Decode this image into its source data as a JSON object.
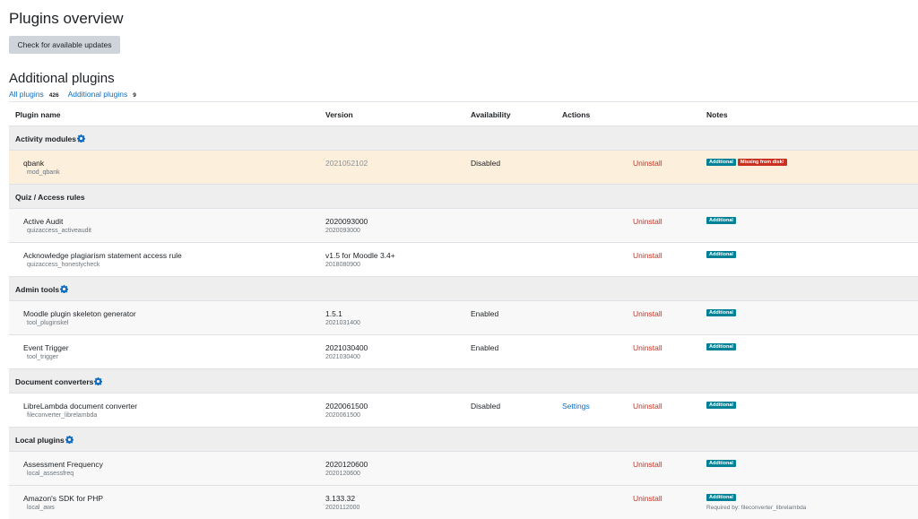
{
  "page_title": "Plugins overview",
  "check_updates_label": "Check for available updates",
  "section_title": "Additional plugins",
  "filters": {
    "all_label": "All plugins",
    "all_count": "426",
    "additional_label": "Additional plugins",
    "additional_count": "9"
  },
  "columns": [
    "Plugin name",
    "Version",
    "Availability",
    "Actions",
    "Notes"
  ],
  "labels": {
    "uninstall": "Uninstall",
    "settings": "Settings",
    "additional": "Additional",
    "missing": "Missing from disk!"
  },
  "groups": [
    {
      "title": "Activity modules",
      "has_icon": true,
      "plugins": [
        {
          "name": "qbank",
          "component": "mod_qbank",
          "version": "2021052102",
          "version_sub": "",
          "availability": "Disabled",
          "settings": "",
          "missing": true,
          "required_by": ""
        }
      ]
    },
    {
      "title": "Quiz / Access rules",
      "has_icon": false,
      "plugins": [
        {
          "name": "Active Audit",
          "component": "quizaccess_activeaudit",
          "version": "2020093000",
          "version_sub": "2020093000",
          "availability": "",
          "settings": "",
          "missing": false,
          "required_by": ""
        },
        {
          "name": "Acknowledge plagiarism statement access rule",
          "component": "quizaccess_honestycheck",
          "version": "v1.5 for Moodle 3.4+",
          "version_sub": "2018080900",
          "availability": "",
          "settings": "",
          "missing": false,
          "required_by": ""
        }
      ]
    },
    {
      "title": "Admin tools",
      "has_icon": true,
      "plugins": [
        {
          "name": "Moodle plugin skeleton generator",
          "component": "tool_pluginskel",
          "version": "1.5.1",
          "version_sub": "2021031400",
          "availability": "Enabled",
          "settings": "",
          "missing": false,
          "required_by": ""
        },
        {
          "name": "Event Trigger",
          "component": "tool_trigger",
          "version": "2021030400",
          "version_sub": "2021030400",
          "availability": "Enabled",
          "settings": "",
          "missing": false,
          "required_by": ""
        }
      ]
    },
    {
      "title": "Document converters",
      "has_icon": true,
      "plugins": [
        {
          "name": "LibreLambda document converter",
          "component": "fileconverter_librelambda",
          "version": "2020061500",
          "version_sub": "2020061500",
          "availability": "Disabled",
          "settings": "Settings",
          "missing": false,
          "required_by": ""
        }
      ]
    },
    {
      "title": "Local plugins",
      "has_icon": true,
      "plugins": [
        {
          "name": "Assessment Frequency",
          "component": "local_assessfreq",
          "version": "2020120600",
          "version_sub": "2020120600",
          "availability": "",
          "settings": "",
          "missing": false,
          "required_by": ""
        },
        {
          "name": "Amazon's SDK for PHP",
          "component": "local_aws",
          "version": "3.133.32",
          "version_sub": "2020112000",
          "availability": "",
          "settings": "",
          "missing": false,
          "required_by": "Required by: fileconverter_librelambda"
        }
      ]
    }
  ]
}
